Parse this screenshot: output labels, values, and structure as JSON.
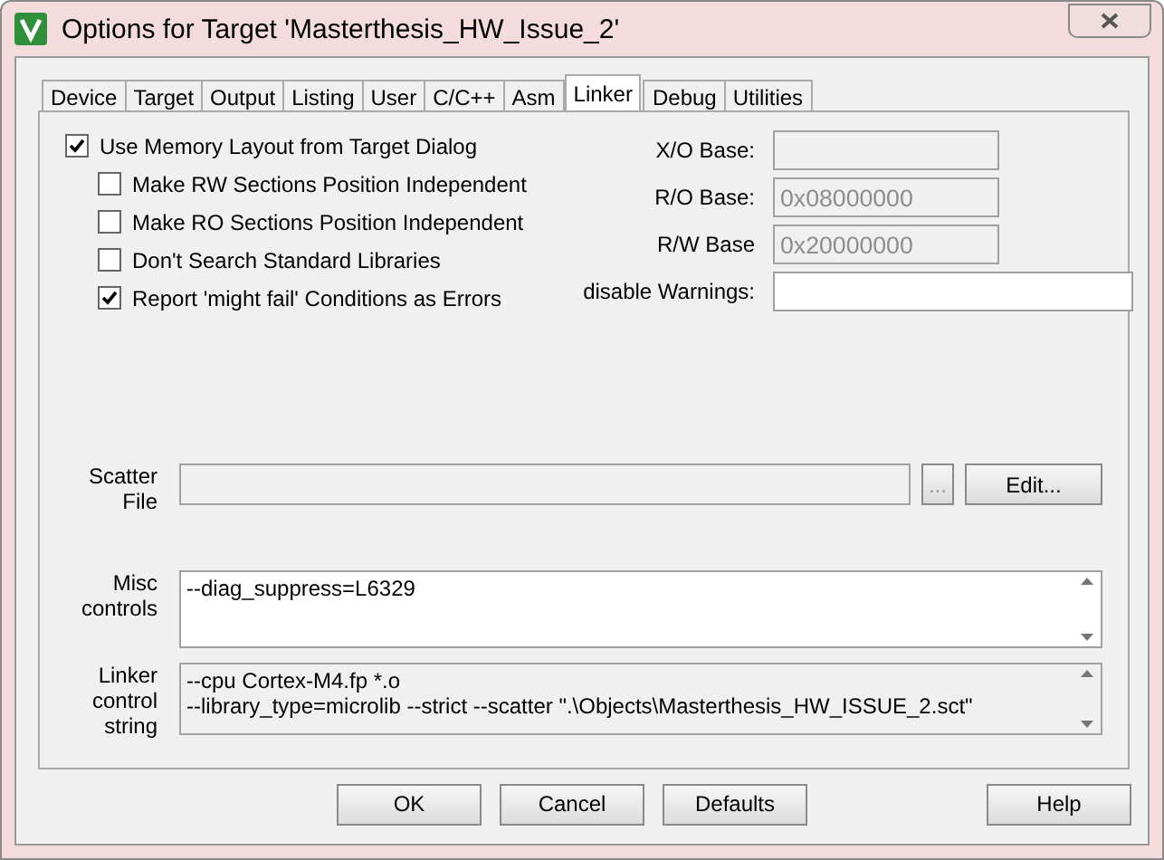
{
  "window": {
    "title": "Options for Target 'Masterthesis_HW_Issue_2'"
  },
  "tabs": [
    {
      "label": "Device",
      "selected": false
    },
    {
      "label": "Target",
      "selected": false
    },
    {
      "label": "Output",
      "selected": false
    },
    {
      "label": "Listing",
      "selected": false
    },
    {
      "label": "User",
      "selected": false
    },
    {
      "label": "C/C++",
      "selected": false
    },
    {
      "label": "Asm",
      "selected": false
    },
    {
      "label": "Linker",
      "selected": true
    },
    {
      "label": "Debug",
      "selected": false
    },
    {
      "label": "Utilities",
      "selected": false
    }
  ],
  "options": [
    {
      "label": "Use Memory Layout from Target Dialog",
      "checked": true,
      "children": [
        {
          "label": "Make RW Sections Position Independent",
          "checked": false
        },
        {
          "label": "Make RO Sections Position Independent",
          "checked": false
        },
        {
          "label": "Don't Search Standard Libraries",
          "checked": false
        },
        {
          "label": "Report 'might fail' Conditions as Errors",
          "checked": true
        }
      ]
    }
  ],
  "addresses": [
    {
      "label": "X/O Base:",
      "disabled": true
    },
    {
      "label": "R/O Base:",
      "value": "0x08000000",
      "disabled": true
    },
    {
      "label": "R/W Base",
      "value": "0x20000000",
      "disabled": true
    },
    {
      "label": "disable Warnings:",
      "disabled": false
    }
  ],
  "scatter_file": {
    "label": "Scatter File",
    "disabled": true,
    "browse_button": "...",
    "edit_button": "Edit..."
  },
  "misc_controls": {
    "label": "Misc controls",
    "lines": [
      "--diag_suppress=L6329"
    ]
  },
  "linker_control_string": {
    "label": "Linker control string",
    "lines": [
      "--cpu Cortex-M4.fp *.o",
      "--library_type=microlib --strict --scatter \".\\Objects\\Masterthesis_HW_ISSUE_2.sct\""
    ]
  },
  "buttons": [
    "OK",
    "Cancel",
    "Defaults",
    "Help"
  ]
}
